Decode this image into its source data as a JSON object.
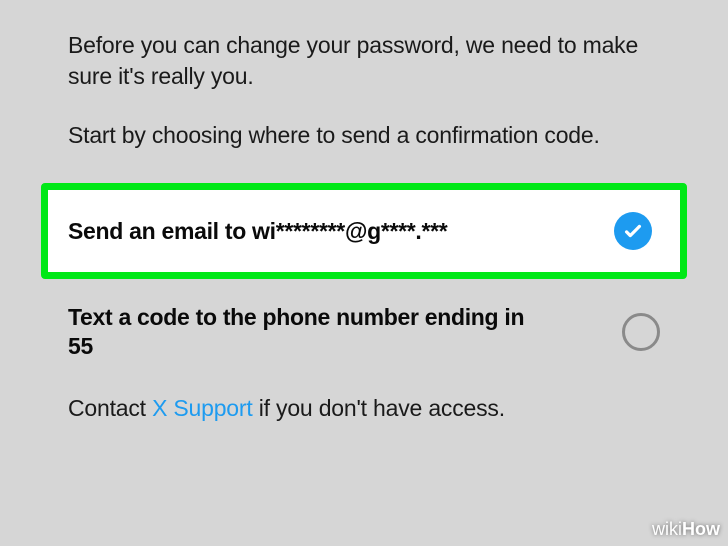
{
  "intro": "Before you can change your password, we need to make sure it's really you.",
  "subIntro": "Start by choosing where to send a confirmation code.",
  "options": {
    "email": {
      "label": "Send an email to wi********@g****.***",
      "selected": true
    },
    "phone": {
      "label": "Text a code to the phone number ending in 55",
      "selected": false
    }
  },
  "footer": {
    "prefix": "Contact ",
    "linkText": "X Support",
    "suffix": " if you don't have access."
  },
  "colors": {
    "highlight": "#00e817",
    "accent": "#1d9bf0"
  },
  "watermark": {
    "part1": "wiki",
    "part2": "How"
  }
}
